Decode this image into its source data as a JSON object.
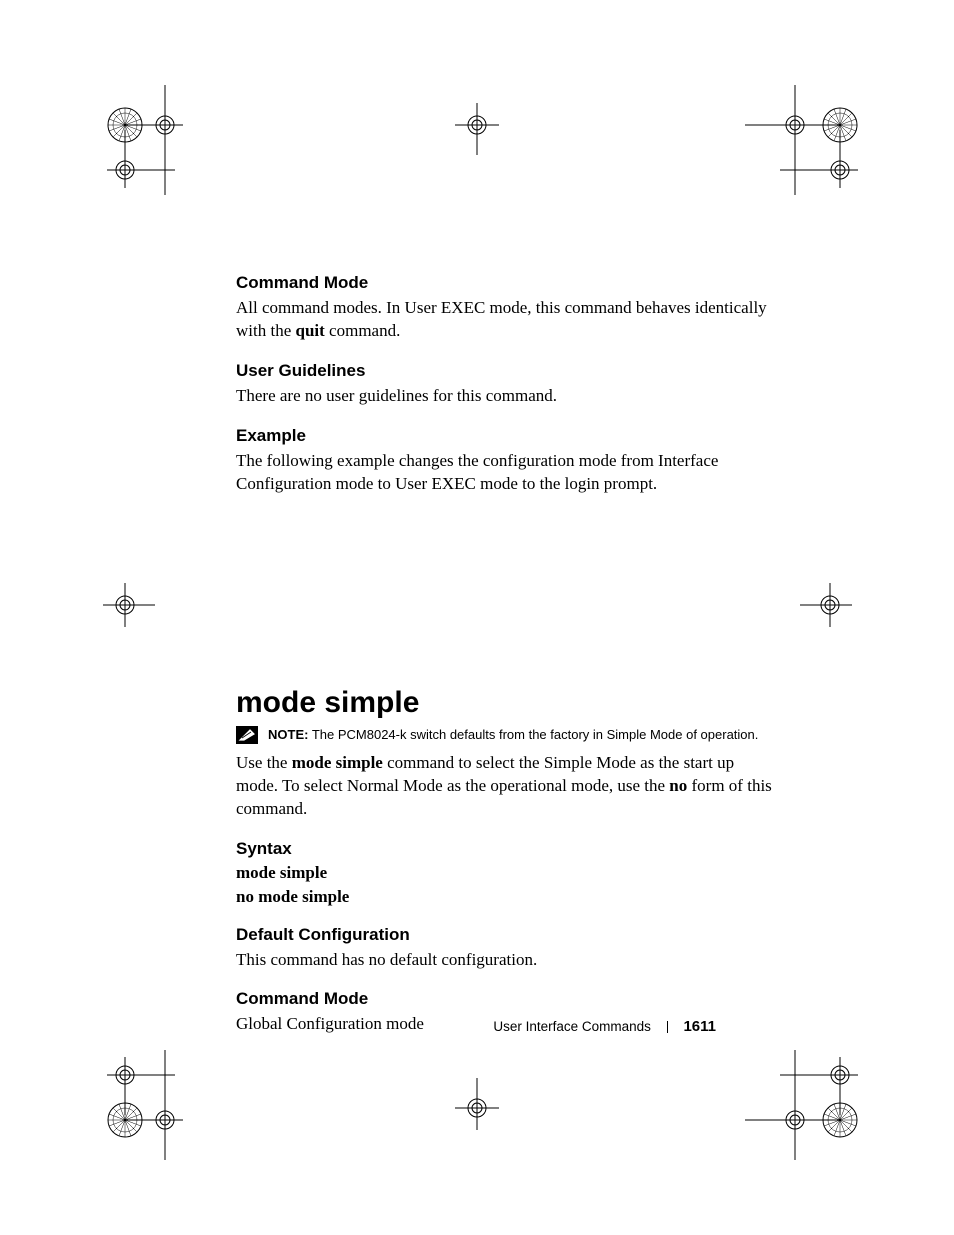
{
  "sections": {
    "command_mode_1": {
      "heading": "Command Mode",
      "text_a": "All command modes. In User EXEC mode, this command behaves identically with the ",
      "bold": "quit",
      "text_b": " command."
    },
    "user_guidelines": {
      "heading": "User Guidelines",
      "text": "There are no user guidelines for this command."
    },
    "example": {
      "heading": "Example",
      "text": "The following example changes the configuration mode from Interface Configuration mode to User EXEC mode to the login prompt."
    },
    "mode_simple": {
      "title": "mode simple",
      "note_label": "NOTE:",
      "note_text": " The PCM8024-k switch defaults from the factory in Simple Mode of operation.",
      "body_a": "Use the ",
      "body_bold1": "mode simple",
      "body_b": " command to select the Simple Mode as the start up mode. To select Normal Mode as the operational mode, use the ",
      "body_bold2": "no",
      "body_c": " form of this command."
    },
    "syntax": {
      "heading": "Syntax",
      "line1": "mode simple",
      "line2": "no mode simple"
    },
    "default_config": {
      "heading": "Default Configuration",
      "text": "This command has no default configuration."
    },
    "command_mode_2": {
      "heading": "Command Mode",
      "text": "Global Configuration mode"
    }
  },
  "footer": {
    "section": "User Interface Commands",
    "page": "1611"
  }
}
